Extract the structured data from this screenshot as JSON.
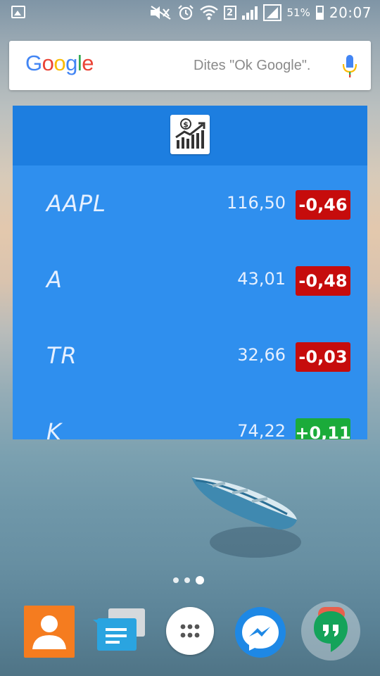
{
  "statusbar": {
    "sim_slot": "2",
    "battery_percent": "51%",
    "battery_level": 0.51,
    "time": "20:07",
    "icons": [
      "gallery-icon",
      "mute-icon",
      "alarm-icon",
      "wifi-icon",
      "sim-2-icon",
      "signal-icon",
      "signal-icon",
      "battery-icon"
    ]
  },
  "search": {
    "logo_text": [
      "G",
      "o",
      "o",
      "g",
      "l",
      "e"
    ],
    "hint": "Dites \"Ok Google\".",
    "mic_icon": "microphone-icon"
  },
  "widget": {
    "app_icon": "stock-chart-icon",
    "stocks": [
      {
        "symbol": "AAPL",
        "price": "116,50",
        "change": "-0,46",
        "direction": "down"
      },
      {
        "symbol": "A",
        "price": "43,01",
        "change": "-0,48",
        "direction": "down"
      },
      {
        "symbol": "TR",
        "price": "32,66",
        "change": "-0,03",
        "direction": "down"
      },
      {
        "symbol": "K",
        "price": "74,22",
        "change": "+0,11",
        "direction": "up"
      }
    ],
    "colors": {
      "down": "#c60c0c",
      "up": "#1bab3a",
      "background": "#2f8fee",
      "header": "#1d7ee0"
    }
  },
  "home": {
    "page_count": 3,
    "active_page": 3
  },
  "dock": [
    {
      "name": "contacts",
      "icon": "contacts-icon"
    },
    {
      "name": "messages",
      "icon": "messages-icon"
    },
    {
      "name": "apps",
      "icon": "app-drawer-icon"
    },
    {
      "name": "messenger",
      "icon": "messenger-icon"
    },
    {
      "name": "hangouts",
      "icon": "hangouts-icon"
    }
  ]
}
